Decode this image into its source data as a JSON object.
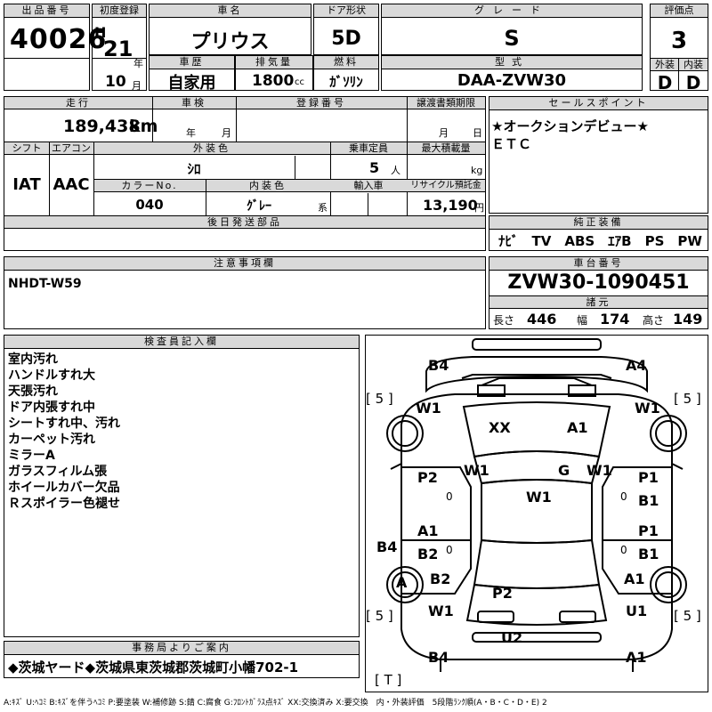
{
  "top": {
    "lot_label": "出品番号",
    "lot_number": "40026",
    "first_reg_label": "初度登録",
    "era": "H",
    "year": "21",
    "year_unit": "年",
    "month": "10",
    "month_unit": "月",
    "car_name_label": "車名",
    "car_name": "プリウス",
    "door_label": "ドア形状",
    "door": "5D",
    "grade_label": "グレード",
    "grade": "S",
    "score_label": "評価点",
    "score": "3",
    "history_label": "車歴",
    "history": "自家用",
    "displacement_label": "排気量",
    "displacement": "1800",
    "displacement_unit": "cc",
    "fuel_label": "燃料",
    "fuel": "ｶﾞｿﾘﾝ",
    "model_label": "型式",
    "model": "DAA-ZVW30",
    "exterior_label": "外装",
    "exterior": "D",
    "interior_label": "内装",
    "interior": "D"
  },
  "mid": {
    "mileage_label": "走行",
    "mileage": "189,438",
    "mileage_unit": "km",
    "inspection_label": "車検",
    "year_unit": "年",
    "month_unit": "月",
    "reg_no_label": "登録番号",
    "transfer_label": "譲渡書類期限",
    "day_unit": "日",
    "sales_label": "セールスポイント",
    "sales_points": [
      "★オークションデビュー★",
      "ＥＴＣ"
    ],
    "shift_label": "シフト",
    "shift": "IAT",
    "ac_label": "エアコン",
    "ac": "AAC",
    "ext_color_label": "外装色",
    "ext_color": "ｼﾛ",
    "capacity_label": "乗車定員",
    "capacity": "5",
    "capacity_unit": "人",
    "load_label": "最大積載量",
    "load_unit": "kg",
    "color_no_label": "カラーNo.",
    "color_no": "040",
    "int_color_label": "内装色",
    "int_color": "ｸﾞﾚｰ",
    "int_color_unit": "系",
    "import_label": "輸入車",
    "recycle_label": "リサイクル預託金",
    "recycle": "13,190",
    "recycle_unit": "円",
    "later_parts_label": "後日発送部品",
    "equipment_label": "純正装備",
    "equipment": "ﾅﾋﾞ　TV　ABS　ｴｱB　PS　PW"
  },
  "caution": {
    "label": "注意事項欄",
    "text": "NHDT-W59"
  },
  "chassis": {
    "label": "車台番号",
    "number": "ZVW30-1090451",
    "specs_label": "諸元",
    "length_label": "長さ",
    "length": "446",
    "width_label": "幅",
    "width": "174",
    "height_label": "高さ",
    "height": "149"
  },
  "inspector": {
    "label": "検査員記入欄",
    "notes": [
      "室内汚れ",
      "ハンドルすれ大",
      "天張汚れ",
      "ドア内張すれ中",
      "シートすれ中、汚れ",
      "カーペット汚れ",
      "ミラーA",
      "ガラスフィルム張",
      "ホイールカバー欠品",
      "Ｒスポイラー色褪せ"
    ]
  },
  "office": {
    "label": "事務局よりご案内",
    "text": "◆茨城ヤード◆茨城県東茨城郡茨城町小幡702-1"
  },
  "legend": "A:ｷｽﾞ U:ﾍｺﾐ B:ｷｽﾞを伴うﾍｺﾐ P:要塗装 W:補修跡 S:錆 C:腐食 G:ﾌﾛﾝﾄｶﾞﾗｽ点ｷｽﾞ XX:交換済み X:要交換　内・外装評価　5段階ﾗﾝｸ順(A・B・C・D・E) 2",
  "diagram": {
    "marks": {
      "b4_top_left": "B4",
      "a4_top_right": "A4",
      "tread_fl": "[ 5 ]",
      "tread_fr": "[ 5 ]",
      "tread_rl": "[ 5 ]",
      "tread_rr": "[ 5 ]",
      "spare": "[ T ]",
      "w1_front_left": "W1",
      "w1_front_right": "W1",
      "xx_hood": "XX",
      "a1_hood": "A1",
      "w1_pillar_left": "W1",
      "g_glass": "G",
      "w1_pillar_right": "W1",
      "w1_roof": "W1",
      "p2_left_front_door": "P2",
      "p1_right_front_door": "P1",
      "b1_right_front_door": "B1",
      "a1_left_rear_door": "A1",
      "b2_left_rear_door": "B2",
      "p1_right_rear_door": "P1",
      "b1_right_rear_door": "B1",
      "b4_left_side": "B4",
      "a_left_rear_wheel": "A",
      "b2_left_rear": "B2",
      "w1_left_rear": "W1",
      "p2_trunk": "P2",
      "a1_right_rear": "A1",
      "u1_right_rear": "U1",
      "u2_rear_bumper": "U2",
      "b4_bottom_left": "B4",
      "a1_bottom_right": "A1",
      "zero_left_front": "0",
      "zero_right_front": "0",
      "zero_left_rear": "0",
      "zero_right_rear": "0"
    }
  }
}
